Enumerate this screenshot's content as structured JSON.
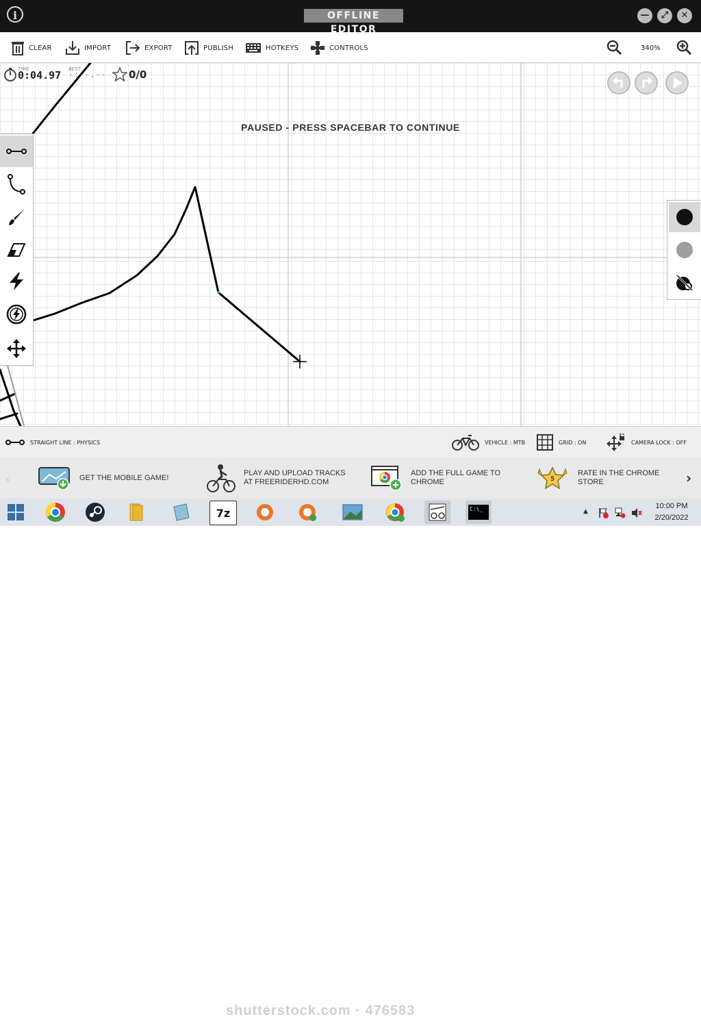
{
  "titlebar": {
    "title": "OFFLINE EDITOR",
    "info_glyph": "i",
    "minimize_glyph": "—",
    "maximize_glyph": "⤢",
    "close_glyph": "✕"
  },
  "toolbar": {
    "items": [
      {
        "label": "CLEAR",
        "icon": "trash-icon"
      },
      {
        "label": "IMPORT",
        "icon": "import-icon"
      },
      {
        "label": "EXPORT",
        "icon": "export-icon"
      },
      {
        "label": "PUBLISH",
        "icon": "publish-icon"
      },
      {
        "label": "HOTKEYS",
        "icon": "keyboard-icon"
      },
      {
        "label": "CONTROLS",
        "icon": "gamepad-icon"
      }
    ],
    "zoom": "340%"
  },
  "hud": {
    "time_label": "TIME",
    "time": "0:04.97",
    "best_label": "BEST",
    "best": "-:--.--",
    "stars": "0/0"
  },
  "overlay": {
    "paused": "PAUSED - PRESS SPACEBAR TO CONTINUE"
  },
  "tools": [
    "straight-line",
    "curve",
    "brush",
    "eraser",
    "powerup",
    "boost",
    "move"
  ],
  "colors": {
    "physics": "#111111",
    "scenery": "#9e9e9e"
  },
  "status": {
    "tool": "STRAIGHT LINE : PHYSICS",
    "vehicle": "VEHICLE : MTB",
    "grid": "GRID : ON",
    "camera": "CAMERA LOCK : OFF"
  },
  "promo": {
    "items": [
      {
        "line1": "GET THE MOBILE GAME!",
        "line2": ""
      },
      {
        "line1": "PLAY AND UPLOAD TRACKS",
        "line2": "AT FREERIDERHD.COM"
      },
      {
        "line1": "ADD THE FULL GAME TO",
        "line2": "CHROME"
      },
      {
        "line1": "RATE IN THE CHROME",
        "line2": "STORE"
      }
    ],
    "badge_number": "5"
  },
  "taskbar": {
    "time": "10:00 PM",
    "date": "2/20/2022",
    "watermark": "shutterstock.com · 476583",
    "sevenzip_label": "7z",
    "terminal_label": "C:\\_"
  }
}
